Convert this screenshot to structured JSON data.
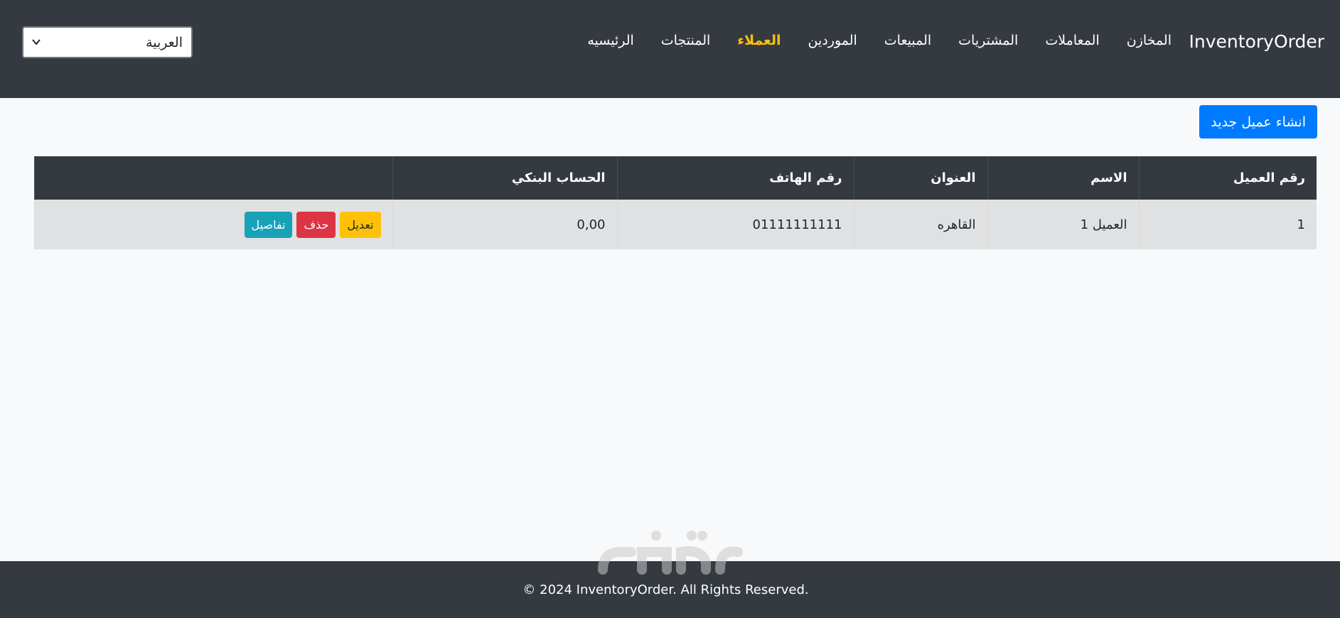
{
  "navbar": {
    "brand": "InventoryOrder",
    "links": [
      {
        "label": "الرئيسيه",
        "active": false
      },
      {
        "label": "المنتجات",
        "active": false
      },
      {
        "label": "العملاء",
        "active": true
      },
      {
        "label": "الموردين",
        "active": false
      },
      {
        "label": "المبيعات",
        "active": false
      },
      {
        "label": "المشتريات",
        "active": false
      },
      {
        "label": "المعاملات",
        "active": false
      },
      {
        "label": "المخازن",
        "active": false
      }
    ],
    "language": {
      "selected": "العربية"
    }
  },
  "main": {
    "new_button": "انشاء عميل جديد",
    "table": {
      "headers": [
        "رقم العميل",
        "الاسم",
        "العنوان",
        "رقم الهاتف",
        "الحساب البنكي",
        ""
      ],
      "rows": [
        {
          "id": "1",
          "name": "العميل 1",
          "address": "القاهره",
          "phone": "01111111111",
          "bank": "0,00",
          "actions": {
            "edit": "تعديل",
            "delete": "حذف",
            "details": "تفاصيل"
          }
        }
      ]
    }
  },
  "footer": {
    "text": "© 2024 InventoryOrder. All Rights Reserved."
  },
  "colors": {
    "navbar_bg": "#343a40",
    "active_link": "#ffc107",
    "primary": "#007bff",
    "warning": "#ffc107",
    "danger": "#dc3545",
    "info": "#17a2b8"
  }
}
